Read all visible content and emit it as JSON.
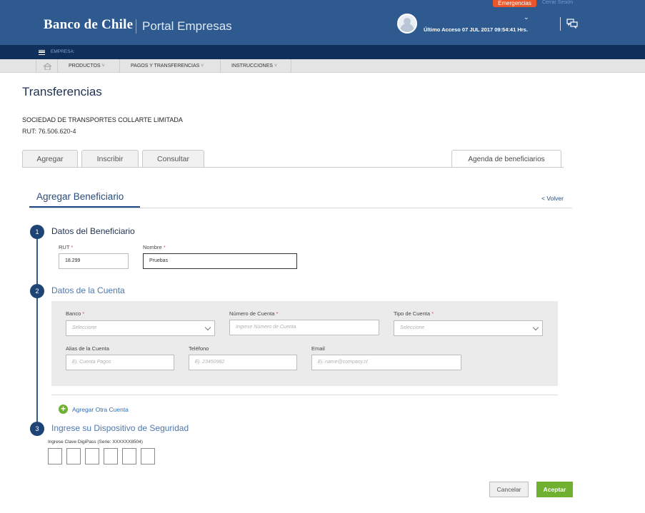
{
  "header": {
    "logo": "Banco de Chile",
    "portal": "Portal Empresas",
    "emergency_label": "Emergencias",
    "logout_label": "Cerrar Sesión",
    "last_access": "Último Acceso 07 JUL 2017 09:54:41 Hrs."
  },
  "empresa_bar": {
    "label": "EMPRESA:"
  },
  "nav": {
    "items": [
      {
        "label": "PRODUCTOS"
      },
      {
        "label": "PAGOS Y TRANSFERENCIAS"
      },
      {
        "label": "INSTRUCCIONES"
      }
    ]
  },
  "page": {
    "title": "Transferencias",
    "company": "SOCIEDAD DE TRANSPORTES COLLARTE LIMITADA",
    "rut": "RUT: 76.506.620-4"
  },
  "tabs": [
    {
      "label": "Agregar"
    },
    {
      "label": "Inscribir"
    },
    {
      "label": "Consultar"
    },
    {
      "label": "Agenda de beneficiarios"
    }
  ],
  "section": {
    "title": "Agregar Beneficiario",
    "back": "< Volver"
  },
  "steps": {
    "s1": {
      "num": "1",
      "title": "Datos del Beneficiario"
    },
    "s2": {
      "num": "2",
      "title": "Datos de la Cuenta"
    },
    "s3": {
      "num": "3",
      "title": "Ingrese su Dispositivo de Seguridad"
    }
  },
  "beneficiary": {
    "rut_label": "RUT",
    "rut_value": "18.299",
    "name_label": "Nombre",
    "name_value": "Pruebas",
    "required_mark": "*"
  },
  "account": {
    "bank_label": "Banco",
    "bank_placeholder": "Seleccione",
    "number_label": "Número de Cuenta",
    "number_placeholder": "Ingrese Número de Cuenta",
    "type_label": "Tipo de Cuenta",
    "type_placeholder": "Seleccione",
    "alias_label": "Alias de la Cuenta",
    "alias_placeholder": "Ej. Cuenta Pagos",
    "phone_label": "Teléfono",
    "phone_placeholder": "Ej. 23450982",
    "email_label": "Email",
    "email_placeholder": "Ej. name@company.cl",
    "add_another": "Agregar Otra Cuenta",
    "add_icon": "+"
  },
  "security": {
    "label": "Ingrese Clave DigiPass (Serie: XXXXXX8504)",
    "pin_count": 6
  },
  "actions": {
    "cancel": "Cancelar",
    "accept": "Aceptar"
  },
  "colors": {
    "header_blue": "#2f5a8f",
    "dark_navy": "#10305c",
    "accent_green": "#6fb031",
    "emergency_orange": "#e8562a"
  }
}
